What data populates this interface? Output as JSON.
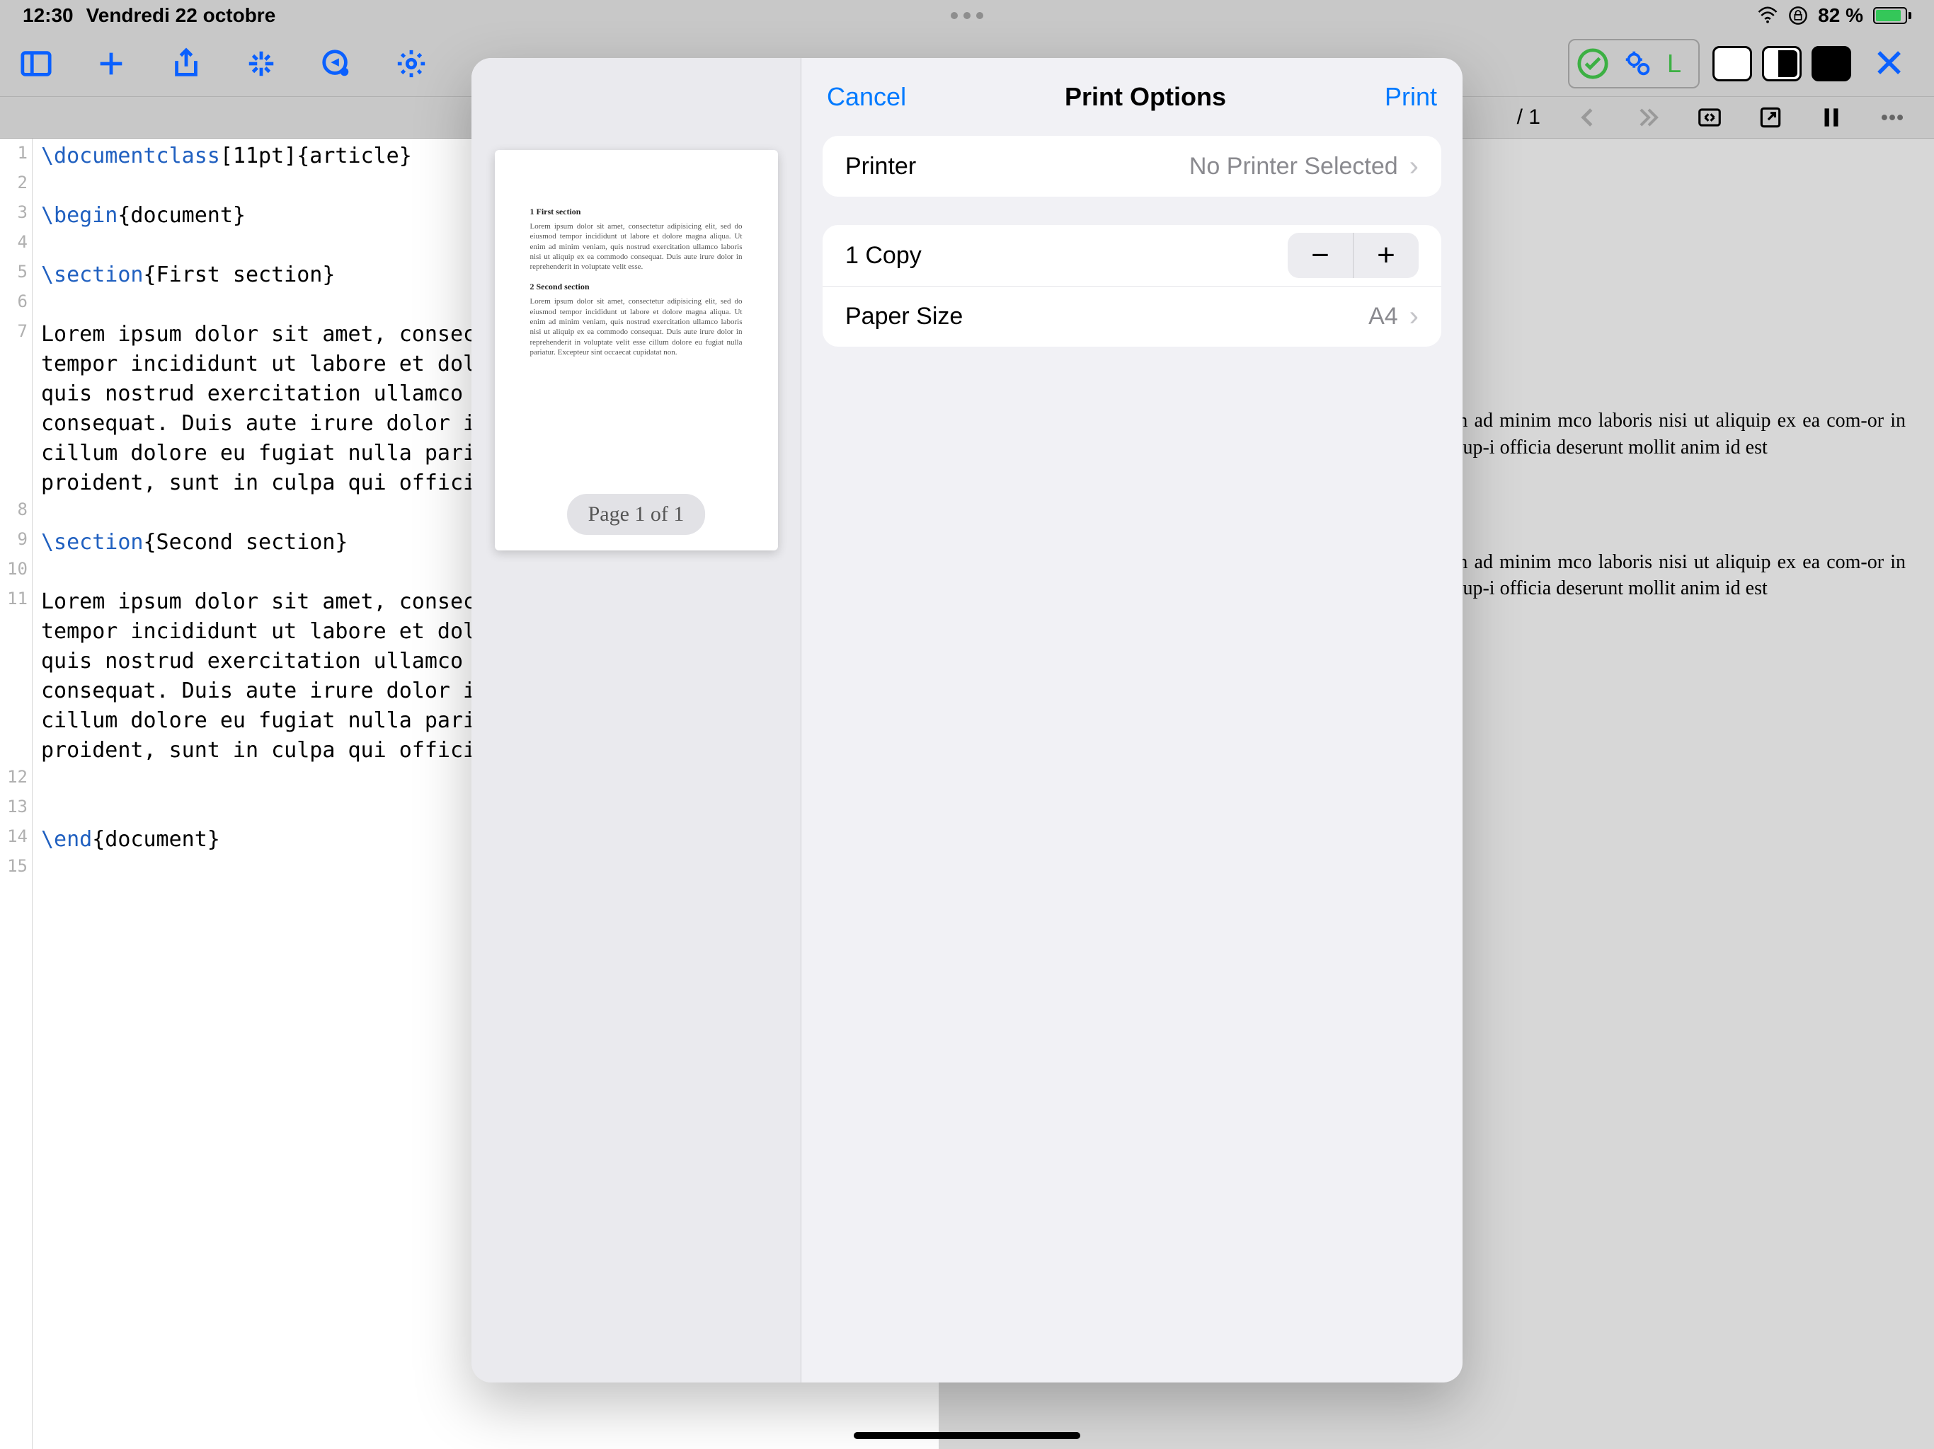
{
  "status": {
    "time": "12:30",
    "date": "Vendredi 22 octobre",
    "battery": "82 %"
  },
  "toolbar": {
    "checkLabel": "L",
    "pageIndicator": "/ 1"
  },
  "editor": {
    "lines": [
      "1",
      "2",
      "3",
      "4",
      "5",
      "6",
      "7",
      "",
      "",
      "",
      "8",
      "9",
      "10",
      "11",
      "",
      "",
      "",
      "",
      "",
      "12",
      "13",
      "14",
      "15"
    ]
  },
  "code": {
    "l1a": "\\documentclass",
    "l1b": "[11pt]{article}",
    "l3a": "\\begin",
    "l3b": "{document}",
    "l5a": "\\section",
    "l5b": "{First section}",
    "l7": "Lorem ipsum dolor sit amet, consecte\ntempor incididunt ut labore et dolor\nquis nostrud exercitation ullamco la\nconsequat. Duis aute irure dolor in \ncillum dolore eu fugiat nulla pariat\nproident, sunt in culpa qui officia ",
    "l9a": "\\section",
    "l9b": "{Second section}",
    "l11": "Lorem ipsum dolor sit amet, consecte\ntempor incididunt ut labore et dolor\nquis nostrud exercitation ullamco la\nconsequat. Duis aute irure dolor in \ncillum dolore eu fugiat nulla pariat\nproident, sunt in culpa qui officia ",
    "l14a": "\\end",
    "l14b": "{document}"
  },
  "preview": {
    "p1": "etur adipisicing elit, sed do eiusmod e magna aliqua.  Ut enim ad minim mco laboris nisi ut aliquip ex ea com-or in reprehenderit in voluptate velit iatur.  Excepteur sint occaecat cup-i officia deserunt mollit anim id est",
    "p2": "etur adipisicing elit, sed do eiusmod e magna aliqua.  Ut enim ad minim mco laboris nisi ut aliquip ex ea com-or in reprehenderit in voluptate velit iatur.  Excepteur sint occaecat cup-i officia deserunt mollit anim id est"
  },
  "modal": {
    "cancel": "Cancel",
    "title": "Print Options",
    "print": "Print",
    "printerLabel": "Printer",
    "printerValue": "No Printer Selected",
    "copies": "1 Copy",
    "paperLabel": "Paper Size",
    "paperValue": "A4",
    "pageBadge": "Page 1 of 1",
    "thumb": {
      "s1": "1   First section",
      "t1": "Lorem ipsum dolor sit amet, consectetur adipisicing elit, sed do eiusmod tempor incididunt ut labore et dolore magna aliqua. Ut enim ad minim veniam, quis nostrud exercitation ullamco laboris nisi ut aliquip ex ea commodo consequat. Duis aute irure dolor in reprehenderit in voluptate velit esse.",
      "s2": "2   Second section",
      "t2": "Lorem ipsum dolor sit amet, consectetur adipisicing elit, sed do eiusmod tempor incididunt ut labore et dolore magna aliqua. Ut enim ad minim veniam, quis nostrud exercitation ullamco laboris nisi ut aliquip ex ea commodo consequat. Duis aute irure dolor in reprehenderit in voluptate velit esse cillum dolore eu fugiat nulla pariatur. Excepteur sint occaecat cupidatat non."
    }
  }
}
